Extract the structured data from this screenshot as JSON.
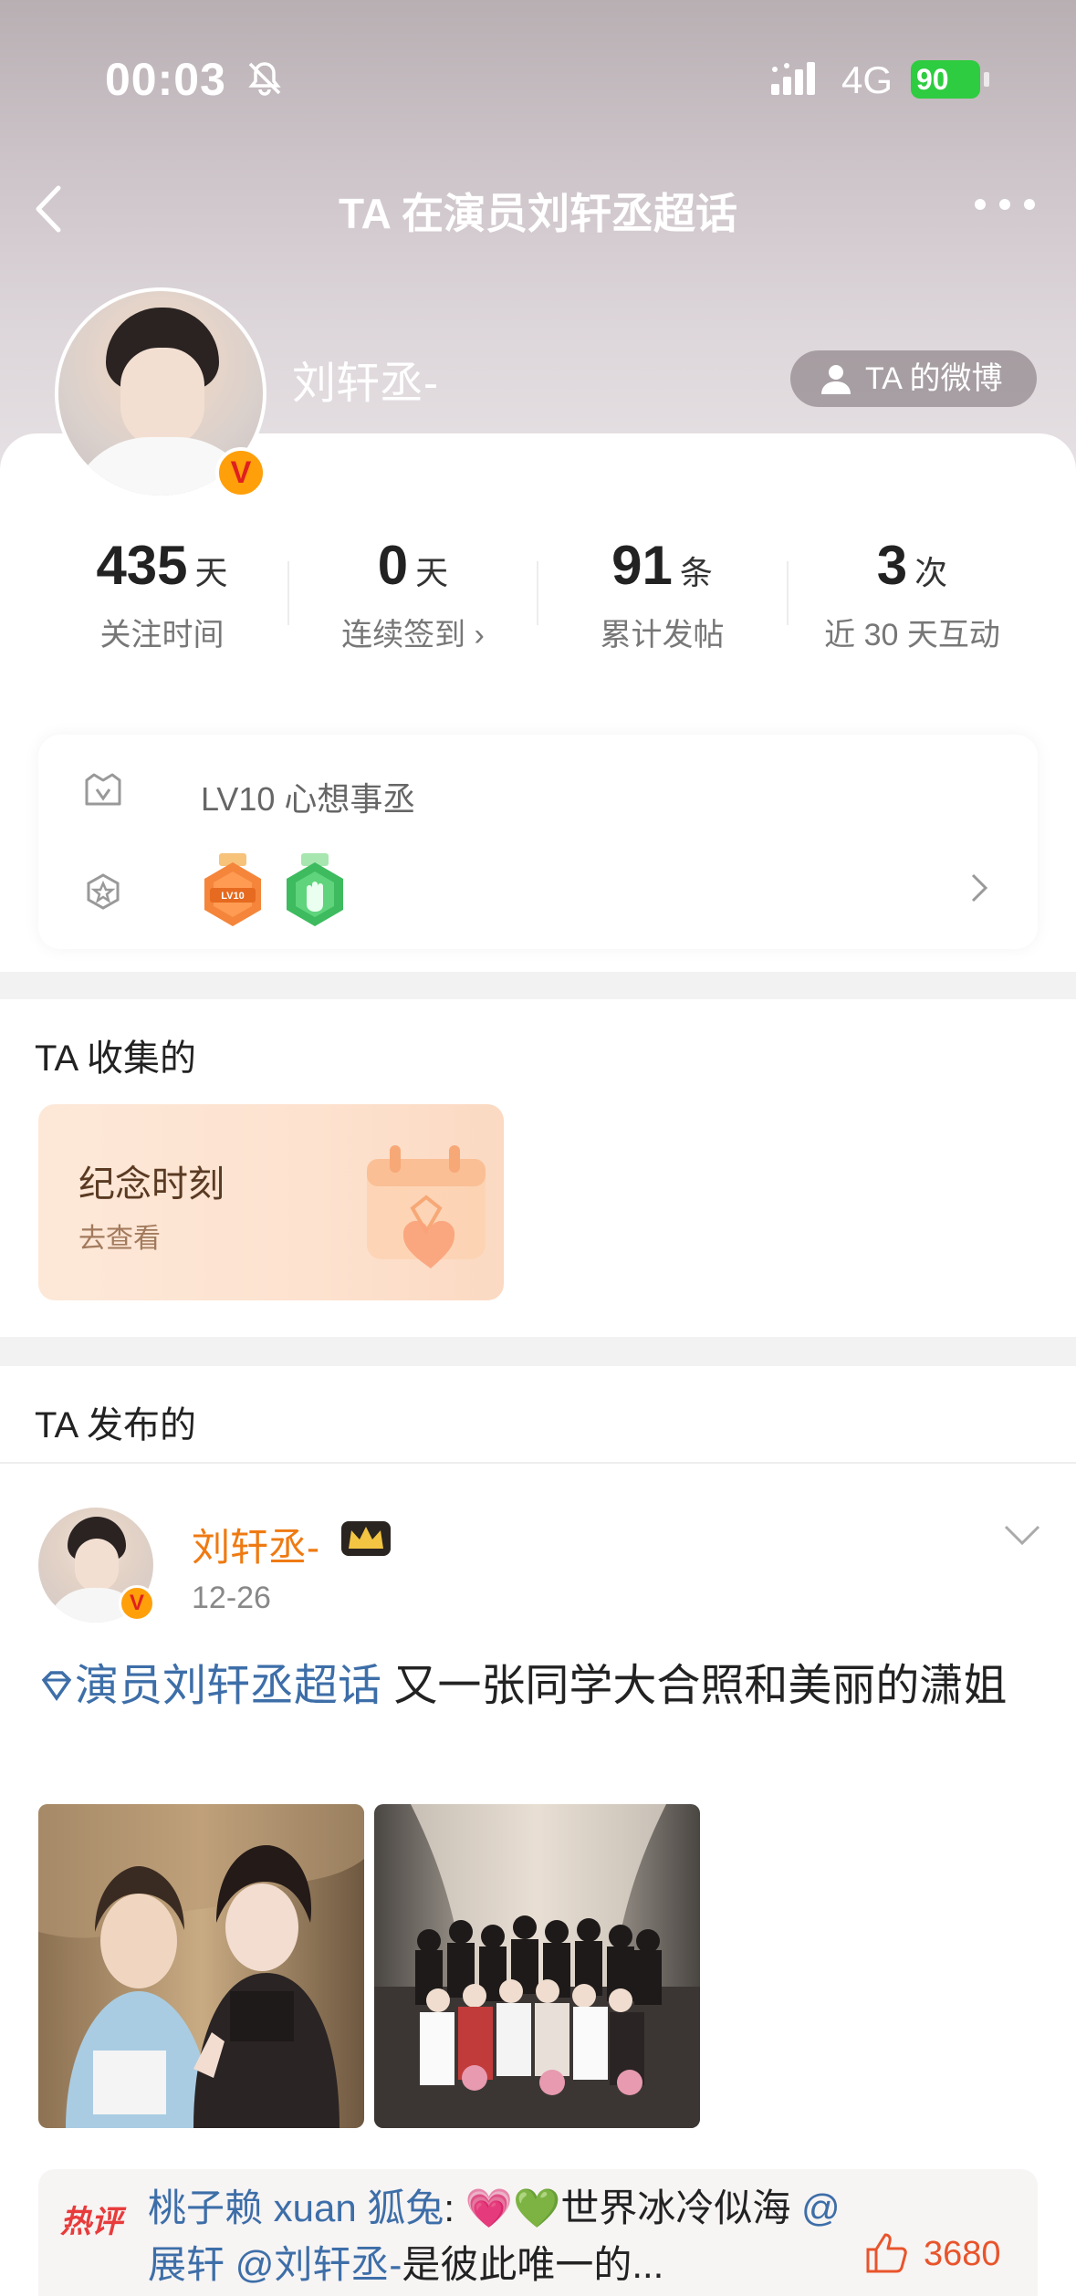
{
  "status_bar": {
    "time": "00:03",
    "network": "4G",
    "battery": "90"
  },
  "nav": {
    "title": "TA 在演员刘轩丞超话"
  },
  "profile": {
    "username": "刘轩丞-",
    "weibo_button": "TA 的微博",
    "verified_mark": "V"
  },
  "stats": [
    {
      "value": "435",
      "unit": "天",
      "label": "关注时间"
    },
    {
      "value": "0",
      "unit": "天",
      "label": "连续签到 ›"
    },
    {
      "value": "91",
      "unit": "条",
      "label": "累计发帖"
    },
    {
      "value": "3",
      "unit": "次",
      "label": "近 30 天互动"
    }
  ],
  "level": {
    "text": "LV10 心想事丞",
    "medal_1_text": "LV10"
  },
  "collected": {
    "title": "TA 收集的",
    "card_title": "纪念时刻",
    "card_link": "去查看"
  },
  "posted": {
    "title": "TA 发布的",
    "post": {
      "author": "刘轩丞-",
      "date": "12-26",
      "topic": "演员刘轩丞超话",
      "text": " 又一张同学大合照和美丽的潇姐",
      "hot_comment": {
        "tag": "热评",
        "user": "桃子赖 xuan 狐兔",
        "sep": ": ",
        "emoji": "💗💚",
        "body": "世界冰冷似海",
        "mention_1": "@展轩",
        "mention_2": "@刘轩丞-",
        "tail": "是彼此唯一的...",
        "likes": "3680"
      }
    }
  },
  "colors": {
    "accent_orange": "#ef7a12",
    "link_blue": "#3d6ea8",
    "hot_red": "#e83b3b",
    "battery_green": "#2ecc40"
  },
  "icons": [
    "back-icon",
    "more-icon",
    "bell-off-icon",
    "signal-icon",
    "person-icon",
    "crown-icon",
    "thumb-up-icon",
    "chevron-down-icon",
    "chevron-right-icon",
    "medal-icon",
    "level-shield-icon",
    "topic-diamond-icon"
  ]
}
